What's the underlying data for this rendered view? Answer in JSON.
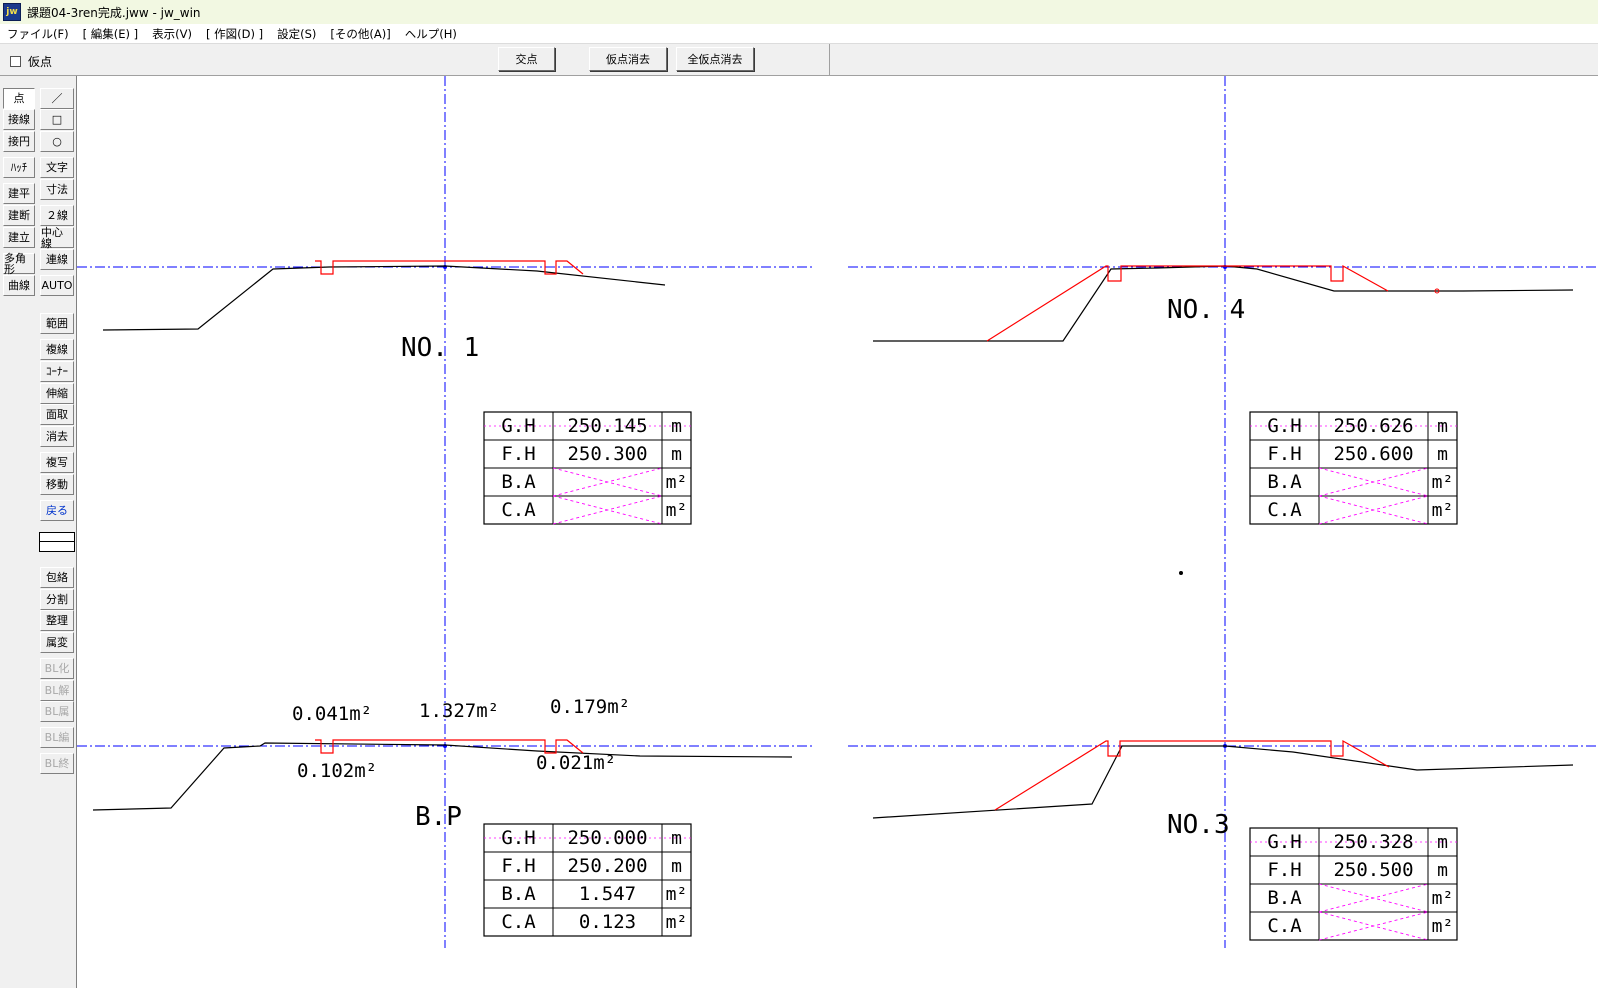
{
  "window": {
    "app_icon_text": "jw",
    "title": "課題04-3ren完成.jww - jw_win"
  },
  "menu": [
    "ファイル(F)",
    "[ 編集(E) ]",
    "表示(V)",
    "[ 作図(D) ]",
    "設定(S)",
    "[その他(A)]",
    "ヘルプ(H)"
  ],
  "controlbar": {
    "checkbox_label": "仮点",
    "btn_intersect": "交点",
    "btn_delete_temp": "仮点消去",
    "btn_delete_all_temp": "全仮点消去"
  },
  "tools_left": [
    "点",
    "接線",
    "接円",
    "ﾊｯﾁ",
    "建平",
    "建断",
    "建立",
    "多角形",
    "曲線"
  ],
  "tools_right_top": [
    "／",
    "□",
    "○",
    "文字",
    "寸法",
    "２線",
    "中心線",
    "連線",
    "AUTO"
  ],
  "tools_right_mid": [
    "範囲",
    "複線",
    "ｺｰﾅｰ",
    "伸縮",
    "面取",
    "消去",
    "複写",
    "移動",
    "戻る"
  ],
  "tools_right_bottom": [
    "包絡",
    "分割",
    "整理",
    "属変",
    "BL化",
    "BL解",
    "BL属",
    "BL編",
    "BL終"
  ],
  "drawing": {
    "colors": {
      "ground": "#000000",
      "design": "#ff0000",
      "centerline": "#0000ff",
      "hatch": "#ff00ff"
    },
    "table_labels": [
      "G.H",
      "F.H",
      "B.A",
      "C.A"
    ],
    "unit_m": "m",
    "unit_m2": "m²",
    "sections": [
      {
        "name": "NO. 1",
        "gh": "250.145",
        "fh": "250.300",
        "ba": "",
        "ca": ""
      },
      {
        "name": "NO. 4",
        "gh": "250.626",
        "fh": "250.600",
        "ba": "",
        "ca": ""
      },
      {
        "name": "B.P",
        "gh": "250.000",
        "fh": "250.200",
        "ba": "1.547",
        "ca": "0.123"
      },
      {
        "name": "NO.3",
        "gh": "250.328",
        "fh": "250.500",
        "ba": "",
        "ca": ""
      }
    ],
    "area_labels": [
      "0.041m²",
      "1.327m²",
      "0.179m²",
      "0.102m²",
      "0.021m²"
    ]
  }
}
